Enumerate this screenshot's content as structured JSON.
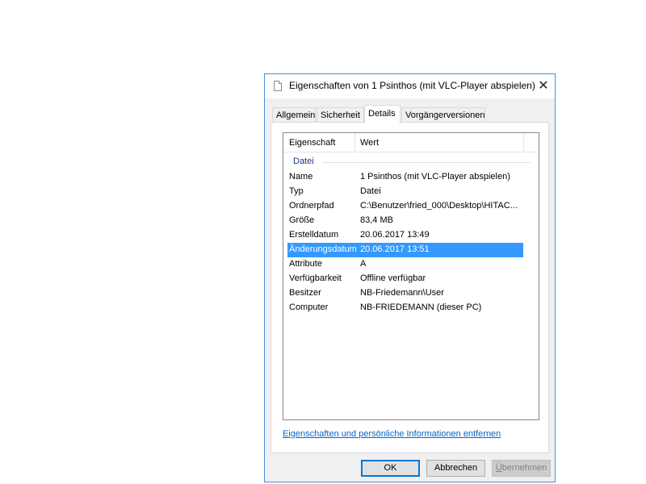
{
  "dialog": {
    "title": "Eigenschaften von 1 Psinthos (mit VLC-Player abspielen)",
    "close_glyph": "✕"
  },
  "tabs": [
    {
      "label": "Allgemein",
      "active": false
    },
    {
      "label": "Sicherheit",
      "active": false
    },
    {
      "label": "Details",
      "active": true
    },
    {
      "label": "Vorgängerversionen",
      "active": false
    }
  ],
  "details": {
    "columns": {
      "property": "Eigenschaft",
      "value": "Wert"
    },
    "group": "Datei",
    "rows": [
      {
        "name": "Name",
        "value": "1 Psinthos (mit VLC-Player abspielen)"
      },
      {
        "name": "Typ",
        "value": "Datei"
      },
      {
        "name": "Ordnerpfad",
        "value": "C:\\Benutzer\\fried_000\\Desktop\\HITAC..."
      },
      {
        "name": "Größe",
        "value": "83,4 MB"
      },
      {
        "name": "Erstelldatum",
        "value": "20.06.2017 13:49"
      },
      {
        "name": "Änderungsdatum",
        "value": "20.06.2017 13:51"
      },
      {
        "name": "Attribute",
        "value": "A"
      },
      {
        "name": "Verfügbarkeit",
        "value": "Offline verfügbar"
      },
      {
        "name": "Besitzer",
        "value": "NB-Friedemann\\User"
      },
      {
        "name": "Computer",
        "value": "NB-FRIEDEMANN (dieser PC)"
      }
    ],
    "selected_row": "Änderungsdatum"
  },
  "link_text": "Eigenschaften und persönliche Informationen entfernen",
  "buttons": {
    "ok": "OK",
    "cancel": "Abbrechen",
    "apply_first": "Ü",
    "apply_rest": "bernehmen"
  },
  "colors": {
    "selection": "#3399ff",
    "link": "#0066cc",
    "group_header": "#1e3287",
    "window_border": "#4a90d9"
  },
  "icons": {
    "title": "document-icon",
    "close": "close-icon"
  }
}
